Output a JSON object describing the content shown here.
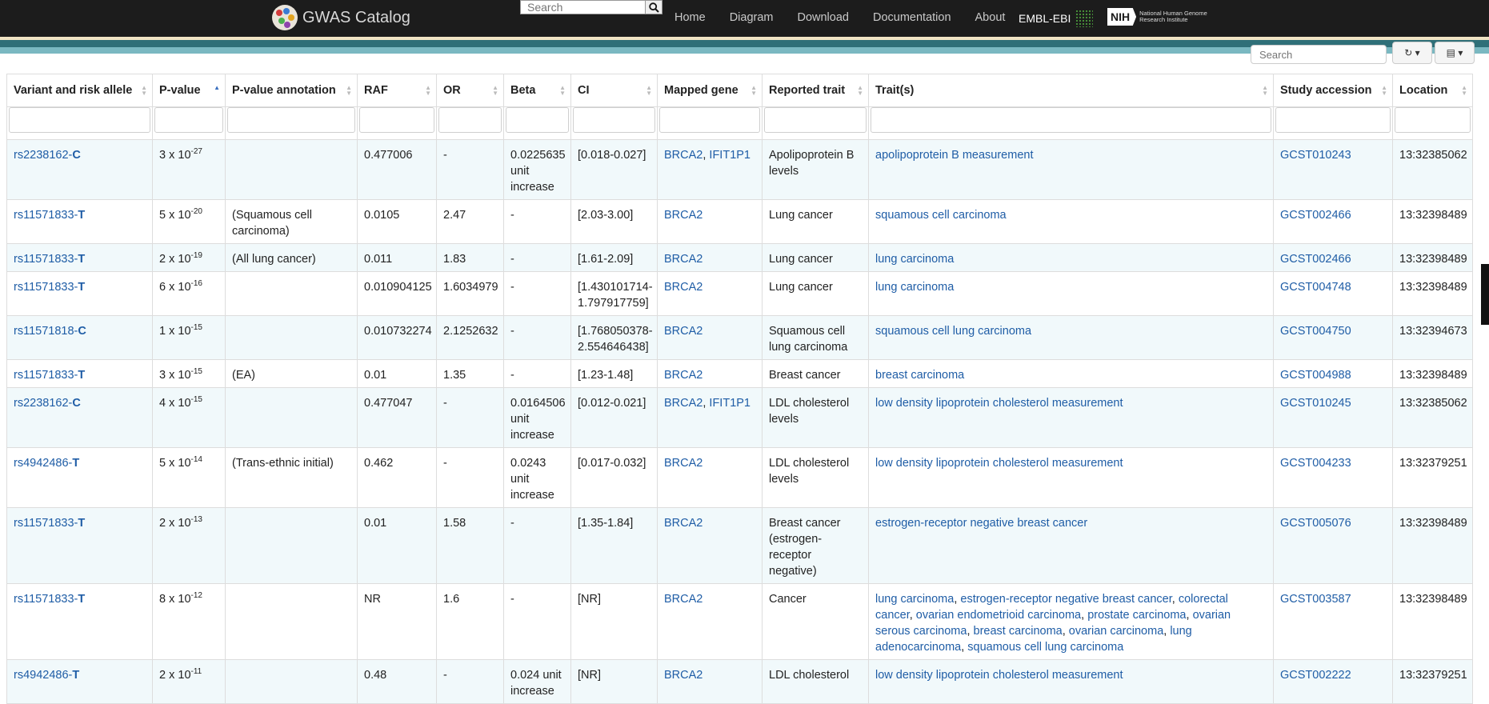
{
  "navbar": {
    "brand": "GWAS Catalog",
    "search_placeholder": "Search",
    "links": [
      "Home",
      "Diagram",
      "Download",
      "Documentation",
      "About"
    ],
    "embl": "EMBL-EBI",
    "nih": "NIH",
    "nih_text": "National Human Genome Research Institute",
    "colors": {
      "bar": "#1c1c1c",
      "teal": "#2f6f78",
      "link": "#1f5da6"
    }
  },
  "toolbar": {
    "search_placeholder": "Search"
  },
  "table": {
    "columns": [
      "Variant and risk allele",
      "P-value",
      "P-value annotation",
      "RAF",
      "OR",
      "Beta",
      "CI",
      "Mapped gene",
      "Reported trait",
      "Trait(s)",
      "Study accession",
      "Location"
    ],
    "rows": [
      {
        "rsid": "rs2238162",
        "allele": "C",
        "p_mant": "3",
        "p_exp": "-27",
        "annotation": "",
        "raf": "0.477006",
        "or": "-",
        "beta": "0.0225635 unit increase",
        "ci": "[0.018-0.027]",
        "genes": [
          "BRCA2",
          "IFIT1P1"
        ],
        "reported": "Apolipoprotein B levels",
        "traits": [
          "apolipoprotein B measurement"
        ],
        "accession": "GCST010243",
        "location": "13:32385062"
      },
      {
        "rsid": "rs11571833",
        "allele": "T",
        "p_mant": "5",
        "p_exp": "-20",
        "annotation": "(Squamous cell carcinoma)",
        "raf": "0.0105",
        "or": "2.47",
        "beta": "-",
        "ci": "[2.03-3.00]",
        "genes": [
          "BRCA2"
        ],
        "reported": "Lung cancer",
        "traits": [
          "squamous cell carcinoma"
        ],
        "accession": "GCST002466",
        "location": "13:32398489"
      },
      {
        "rsid": "rs11571833",
        "allele": "T",
        "p_mant": "2",
        "p_exp": "-19",
        "annotation": "(All lung cancer)",
        "raf": "0.011",
        "or": "1.83",
        "beta": "-",
        "ci": "[1.61-2.09]",
        "genes": [
          "BRCA2"
        ],
        "reported": "Lung cancer",
        "traits": [
          "lung carcinoma"
        ],
        "accession": "GCST002466",
        "location": "13:32398489"
      },
      {
        "rsid": "rs11571833",
        "allele": "T",
        "p_mant": "6",
        "p_exp": "-16",
        "annotation": "",
        "raf": "0.010904125",
        "or": "1.6034979",
        "beta": "-",
        "ci": "[1.430101714-1.797917759]",
        "genes": [
          "BRCA2"
        ],
        "reported": "Lung cancer",
        "traits": [
          "lung carcinoma"
        ],
        "accession": "GCST004748",
        "location": "13:32398489"
      },
      {
        "rsid": "rs11571818",
        "allele": "C",
        "p_mant": "1",
        "p_exp": "-15",
        "annotation": "",
        "raf": "0.010732274",
        "or": "2.1252632",
        "beta": "-",
        "ci": "[1.768050378-2.554646438]",
        "genes": [
          "BRCA2"
        ],
        "reported": "Squamous cell lung carcinoma",
        "traits": [
          "squamous cell lung carcinoma"
        ],
        "accession": "GCST004750",
        "location": "13:32394673"
      },
      {
        "rsid": "rs11571833",
        "allele": "T",
        "p_mant": "3",
        "p_exp": "-15",
        "annotation": "(EA)",
        "raf": "0.01",
        "or": "1.35",
        "beta": "-",
        "ci": "[1.23-1.48]",
        "genes": [
          "BRCA2"
        ],
        "reported": "Breast cancer",
        "traits": [
          "breast carcinoma"
        ],
        "accession": "GCST004988",
        "location": "13:32398489"
      },
      {
        "rsid": "rs2238162",
        "allele": "C",
        "p_mant": "4",
        "p_exp": "-15",
        "annotation": "",
        "raf": "0.477047",
        "or": "-",
        "beta": "0.0164506 unit increase",
        "ci": "[0.012-0.021]",
        "genes": [
          "BRCA2",
          "IFIT1P1"
        ],
        "reported": "LDL cholesterol levels",
        "traits": [
          "low density lipoprotein cholesterol measurement"
        ],
        "accession": "GCST010245",
        "location": "13:32385062"
      },
      {
        "rsid": "rs4942486",
        "allele": "T",
        "p_mant": "5",
        "p_exp": "-14",
        "annotation": "(Trans-ethnic initial)",
        "raf": "0.462",
        "or": "-",
        "beta": "0.0243 unit increase",
        "ci": "[0.017-0.032]",
        "genes": [
          "BRCA2"
        ],
        "reported": "LDL cholesterol levels",
        "traits": [
          "low density lipoprotein cholesterol measurement"
        ],
        "accession": "GCST004233",
        "location": "13:32379251"
      },
      {
        "rsid": "rs11571833",
        "allele": "T",
        "p_mant": "2",
        "p_exp": "-13",
        "annotation": "",
        "raf": "0.01",
        "or": "1.58",
        "beta": "-",
        "ci": "[1.35-1.84]",
        "genes": [
          "BRCA2"
        ],
        "reported": "Breast cancer (estrogen-receptor negative)",
        "traits": [
          "estrogen-receptor negative breast cancer"
        ],
        "accession": "GCST005076",
        "location": "13:32398489"
      },
      {
        "rsid": "rs11571833",
        "allele": "T",
        "p_mant": "8",
        "p_exp": "-12",
        "annotation": "",
        "raf": "NR",
        "or": "1.6",
        "beta": "-",
        "ci": "[NR]",
        "genes": [
          "BRCA2"
        ],
        "reported": "Cancer",
        "traits": [
          "lung carcinoma",
          "estrogen-receptor negative breast cancer",
          "colorectal cancer",
          "ovarian endometrioid carcinoma",
          "prostate carcinoma",
          "ovarian serous carcinoma",
          "breast carcinoma",
          "ovarian carcinoma",
          "lung adenocarcinoma",
          "squamous cell lung carcinoma"
        ],
        "accession": "GCST003587",
        "location": "13:32398489"
      },
      {
        "rsid": "rs4942486",
        "allele": "T",
        "p_mant": "2",
        "p_exp": "-11",
        "annotation": "",
        "raf": "0.48",
        "or": "-",
        "beta": "0.024 unit increase",
        "ci": "[NR]",
        "genes": [
          "BRCA2"
        ],
        "reported": "LDL cholesterol",
        "traits": [
          "low density lipoprotein cholesterol measurement"
        ],
        "accession": "GCST002222",
        "location": "13:32379251"
      }
    ]
  }
}
